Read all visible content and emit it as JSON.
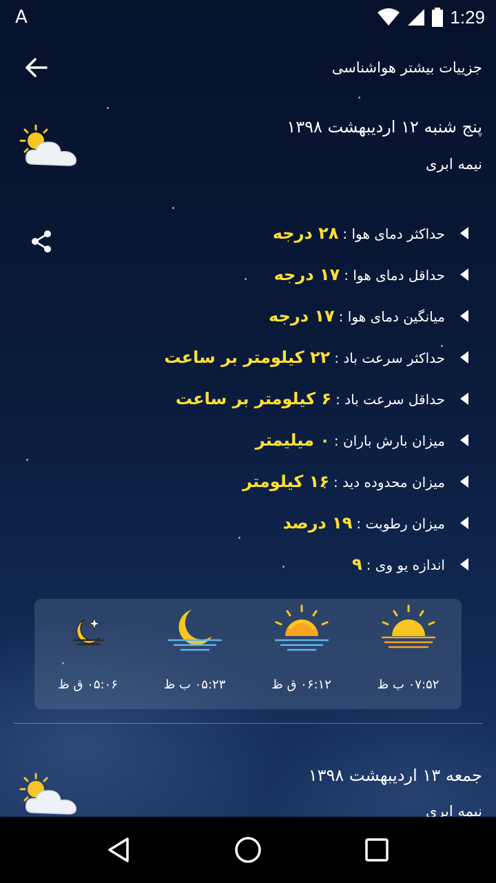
{
  "status_bar": {
    "left_indicator": "A",
    "time": "1:29"
  },
  "app_bar": {
    "title": "جزییات بیشتر هواشناسی",
    "back_icon": "arrow-left-icon"
  },
  "today": {
    "date": "پنج شنبه ۱۲ اردیبهشت ۱۳۹۸",
    "condition": "نیمه ابری",
    "icon": "partly-cloudy-icon"
  },
  "details": [
    {
      "label": "حداکثر دمای هوا :",
      "value": "۲۸ درجه"
    },
    {
      "label": "حداقل دمای هوا :",
      "value": "۱۷ درجه"
    },
    {
      "label": "میانگین دمای هوا :",
      "value": "۱۷ درجه"
    },
    {
      "label": "حداکثر سرعت باد :",
      "value": "۲۲ کیلومتر بر ساعت"
    },
    {
      "label": "حداقل سرعت باد :",
      "value": "۶ کیلومتر بر ساعت"
    },
    {
      "label": "میزان بارش باران :",
      "value": "۰ میلیمتر"
    },
    {
      "label": "میزان محدوده دید :",
      "value": "۱۶ کیلومتر"
    },
    {
      "label": "میزان رطوبت :",
      "value": "۱۹ درصد"
    },
    {
      "label": "اندازه یو وی :",
      "value": "۹"
    }
  ],
  "sun_moon": [
    {
      "icon": "moonrise-icon",
      "time": "۰۵:۰۶ ق ظ"
    },
    {
      "icon": "moonset-icon",
      "time": "۰۵:۲۳ ب ظ"
    },
    {
      "icon": "sunrise-icon",
      "time": "۰۶:۱۲ ق ظ"
    },
    {
      "icon": "sunset-icon",
      "time": "۰۷:۵۲ ب ظ"
    }
  ],
  "next_day": {
    "date": "جمعه ۱۳ اردیبهشت ۱۳۹۸",
    "condition": "نیمه ابری",
    "icon": "partly-cloudy-icon"
  },
  "colors": {
    "value_accent": "#ffe033",
    "sun_orange": "#f7a521",
    "water_blue": "#5fb7e8"
  }
}
